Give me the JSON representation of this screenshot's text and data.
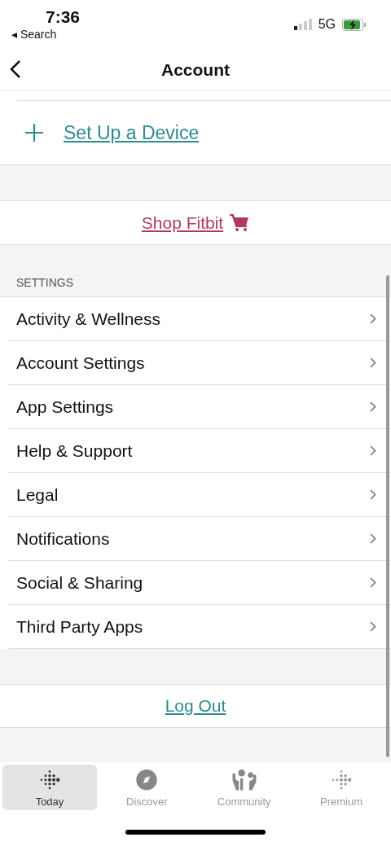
{
  "status_bar": {
    "time": "7:36",
    "back_label": "◂ Search",
    "network": "5G"
  },
  "header": {
    "title": "Account"
  },
  "setup": {
    "label": "Set Up a Device"
  },
  "shop": {
    "label": "Shop Fitbit"
  },
  "settings": {
    "heading": "SETTINGS",
    "items": [
      {
        "label": "Activity & Wellness"
      },
      {
        "label": "Account Settings"
      },
      {
        "label": "App Settings"
      },
      {
        "label": "Help & Support"
      },
      {
        "label": "Legal"
      },
      {
        "label": "Notifications"
      },
      {
        "label": "Social & Sharing"
      },
      {
        "label": "Third Party Apps"
      }
    ]
  },
  "logout": {
    "label": "Log Out"
  },
  "tabs": [
    {
      "label": "Today",
      "kind": "today",
      "selected": true
    },
    {
      "label": "Discover",
      "kind": "discover",
      "selected": false
    },
    {
      "label": "Community",
      "kind": "community",
      "selected": false
    },
    {
      "label": "Premium",
      "kind": "premium",
      "selected": false
    }
  ]
}
